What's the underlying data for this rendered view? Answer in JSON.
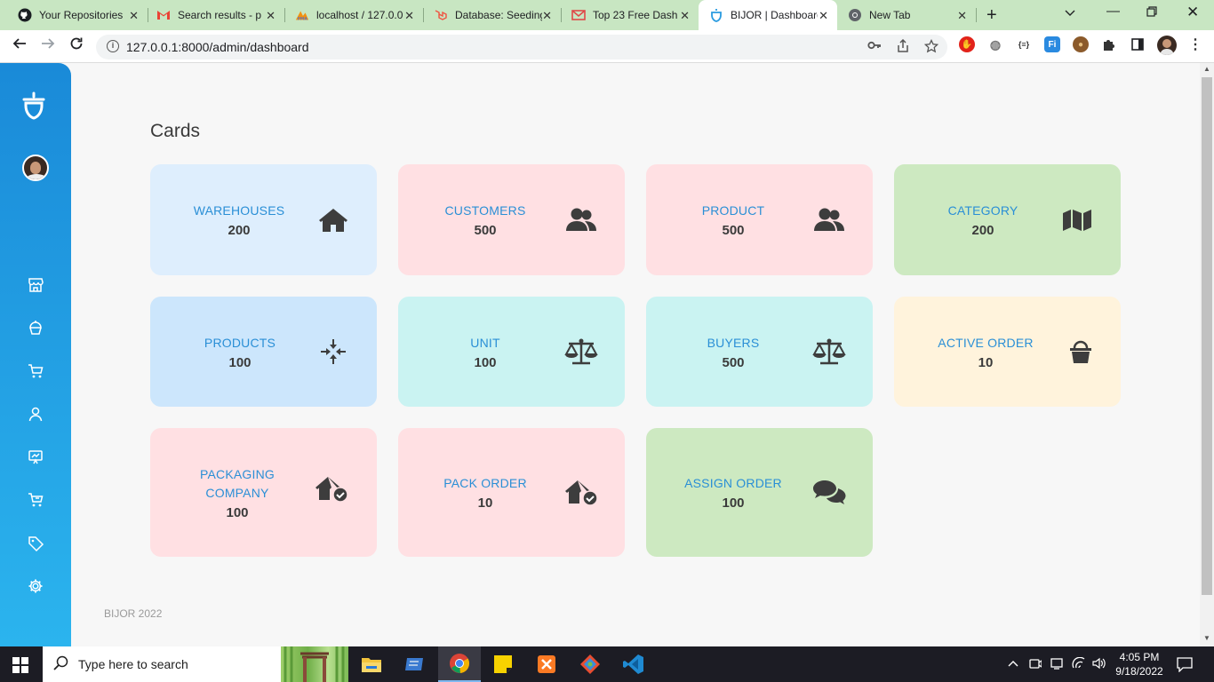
{
  "browser": {
    "tabs": [
      {
        "title": "Your Repositories",
        "favicon": "github-icon"
      },
      {
        "title": "Search results - p",
        "favicon": "gmail-icon"
      },
      {
        "title": "localhost / 127.0.0",
        "favicon": "phpmyadmin-icon"
      },
      {
        "title": "Database: Seeding",
        "favicon": "laravel-icon"
      },
      {
        "title": "Top 23 Free Dash",
        "favicon": "mail-icon"
      },
      {
        "title": "BIJOR | Dashboard",
        "favicon": "acorn-icon",
        "active": true
      },
      {
        "title": "New Tab",
        "favicon": "chrome-icon"
      }
    ],
    "url": "127.0.0.1:8000/admin/dashboard"
  },
  "sidebar": {
    "items": [
      {
        "name": "store",
        "icon": "store-icon"
      },
      {
        "name": "cupcake",
        "icon": "cupcake-icon"
      },
      {
        "name": "cart",
        "icon": "cart-icon"
      },
      {
        "name": "user",
        "icon": "user-icon"
      },
      {
        "name": "monitor",
        "icon": "presentation-icon"
      },
      {
        "name": "cart-alt",
        "icon": "cart-icon"
      },
      {
        "name": "tags",
        "icon": "tag-icon"
      },
      {
        "name": "settings",
        "icon": "gear-icon"
      }
    ]
  },
  "main": {
    "section_title": "Cards",
    "cards": [
      {
        "label": "WAREHOUSES",
        "value": "200",
        "icon": "home-icon",
        "bg": "#deeefd"
      },
      {
        "label": "CUSTOMERS",
        "value": "500",
        "icon": "users-icon",
        "bg": "#ffe0e3"
      },
      {
        "label": "PRODUCT",
        "value": "500",
        "icon": "users-icon",
        "bg": "#ffe0e3"
      },
      {
        "label": "CATEGORY",
        "value": "200",
        "icon": "map-icon",
        "bg": "#cde9c1"
      },
      {
        "label": "PRODUCTS",
        "value": "100",
        "icon": "compress-arrows-icon",
        "bg": "#cce6fc"
      },
      {
        "label": "UNIT",
        "value": "100",
        "icon": "balance-scale-icon",
        "bg": "#caf3f2"
      },
      {
        "label": "BUYERS",
        "value": "500",
        "icon": "balance-scale-icon",
        "bg": "#caf3f2"
      },
      {
        "label": "ACTIVE ORDER",
        "value": "10",
        "icon": "shopping-basket-icon",
        "bg": "#fff3dc"
      },
      {
        "label": "PACKAGING COMPANY",
        "value": "100",
        "icon": "house-check-icon",
        "bg": "#ffe0e3"
      },
      {
        "label": "PACK ORDER",
        "value": "10",
        "icon": "house-check-icon",
        "bg": "#ffe0e3"
      },
      {
        "label": "ASSIGN ORDER",
        "value": "100",
        "icon": "comments-icon",
        "bg": "#cde9c1"
      }
    ],
    "footer": "BIJOR 2022"
  },
  "taskbar": {
    "search_placeholder": "Type here to search",
    "time": "4:05 PM",
    "date": "9/18/2022"
  }
}
